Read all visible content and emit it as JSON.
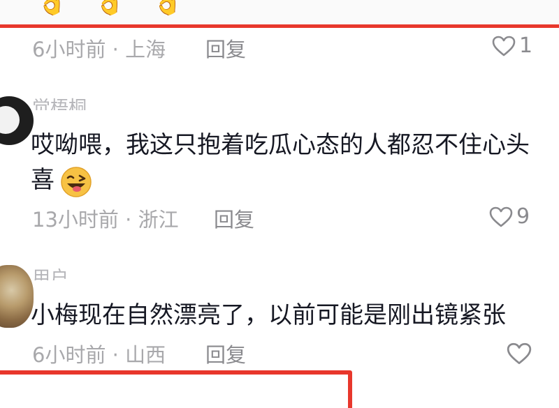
{
  "top": {
    "emojis": [
      "👌",
      "👌",
      "👌"
    ]
  },
  "comments": [
    {
      "username": "",
      "text": "",
      "time": "6小时前",
      "location": "上海",
      "separator": "·",
      "reply_label": "回复",
      "likes": "1"
    },
    {
      "username": "觉梧桐",
      "text_line1": "哎呦喂，我这只抱着吃瓜心态的人都忍不住心头",
      "text_line2": "喜",
      "time": "13小时前",
      "location": "浙江",
      "separator": "·",
      "reply_label": "回复",
      "likes": "9"
    },
    {
      "username": "用户",
      "text": "小梅现在自然漂亮了，以前可能是刚出镜紧张",
      "time": "6小时前",
      "location": "山西",
      "separator": "·",
      "reply_label": "回复",
      "likes": ""
    }
  ],
  "highlight_colors": {
    "annotation_red": "#e8372c"
  },
  "icons": {
    "like": "heart-outline-icon",
    "emoji": "grinning-wink-emoji-icon"
  }
}
